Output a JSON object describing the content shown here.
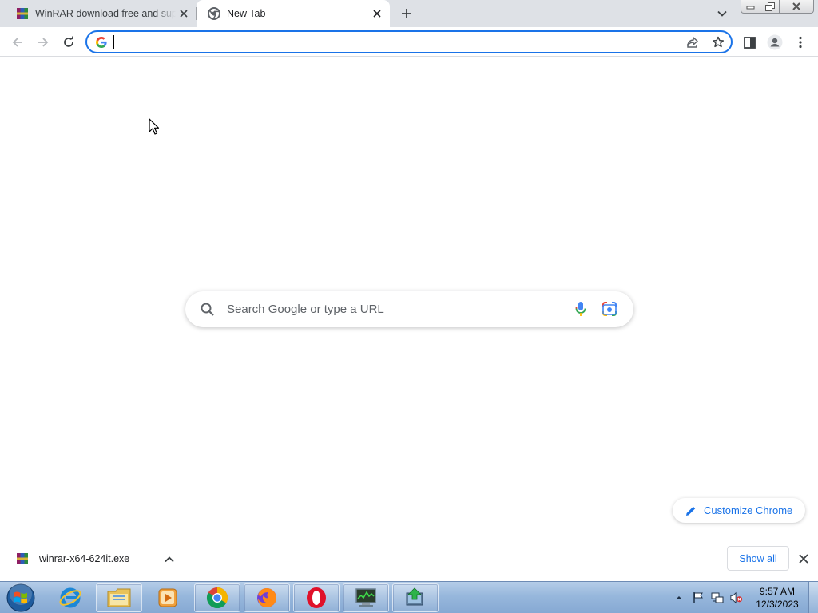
{
  "tabs": [
    {
      "title": "WinRAR download free and support: WinRAR",
      "favicon": "winrar-icon",
      "active": false
    },
    {
      "title": "New Tab",
      "favicon": "chrome-icon",
      "active": true
    }
  ],
  "toolbar": {
    "omnibox_value": "",
    "omnibox_icon": "google-g-icon"
  },
  "ntp": {
    "search_placeholder": "Search Google or type a URL",
    "customize_label": "Customize Chrome"
  },
  "downloads": {
    "file_name": "winrar-x64-624it.exe",
    "show_all_label": "Show all"
  },
  "taskbar": {
    "apps": [
      "internet-explorer-icon",
      "file-explorer-icon",
      "media-player-icon",
      "chrome-icon",
      "firefox-icon",
      "opera-icon",
      "task-manager-icon",
      "install-icon"
    ],
    "clock_time": "9:57 AM",
    "clock_date": "12/3/2023"
  },
  "colors": {
    "accent": "#1a73e8",
    "tabstrip": "#dee1e6",
    "taskbar": "#97b7dc"
  }
}
